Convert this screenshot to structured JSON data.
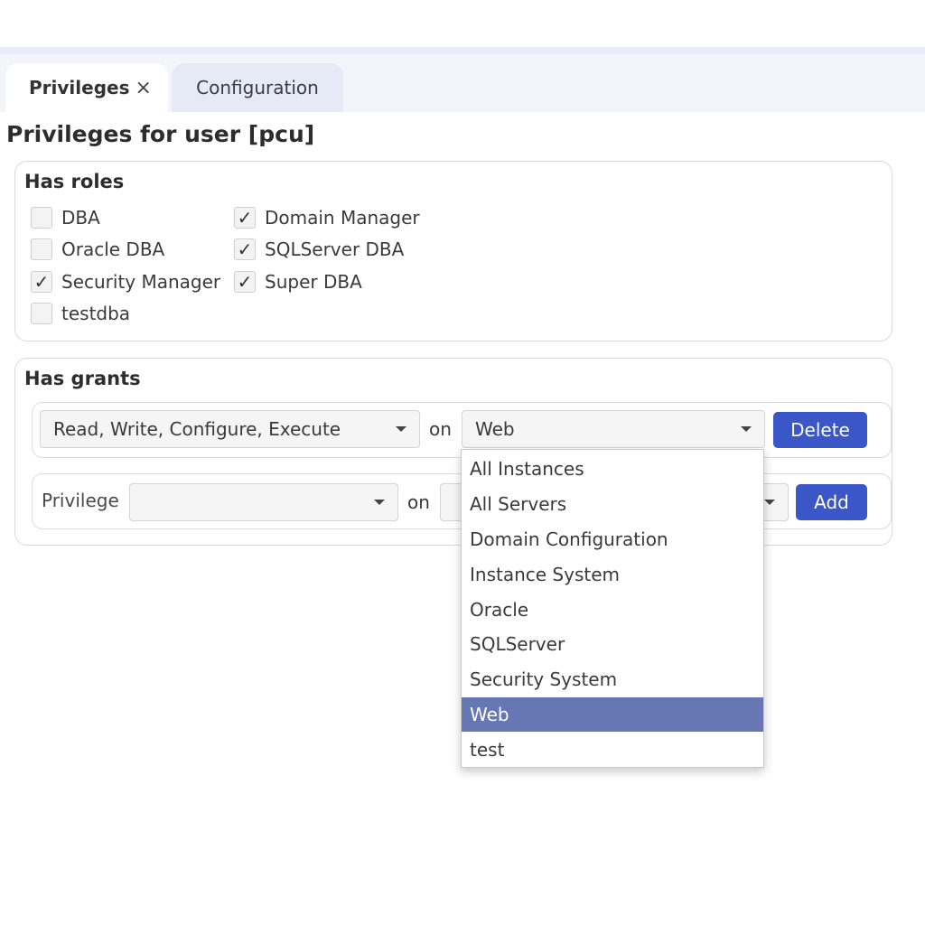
{
  "tabs": {
    "privileges_label": "Privileges",
    "privileges_close": "×",
    "configuration_label": "Configuration"
  },
  "page": {
    "title": "Privileges for user [pcu]"
  },
  "roles": {
    "heading": "Has roles",
    "items": [
      {
        "label": "DBA",
        "checked": false
      },
      {
        "label": "Domain Manager",
        "checked": true
      },
      {
        "label": "Oracle DBA",
        "checked": false
      },
      {
        "label": "SQLServer DBA",
        "checked": true
      },
      {
        "label": "Security Manager",
        "checked": true
      },
      {
        "label": "Super DBA",
        "checked": true
      },
      {
        "label": "testdba",
        "checked": false
      }
    ]
  },
  "grants": {
    "heading": "Has grants",
    "existing": {
      "privilege_value": "Read, Write, Configure, Execute",
      "on_label": "on",
      "target_value": "Web",
      "delete_label": "Delete"
    },
    "new_grant": {
      "privilege_label": "Privilege",
      "privilege_value": "",
      "on_label": "on",
      "add_label": "Add"
    }
  },
  "dropdown": {
    "options": [
      "All Instances",
      "All Servers",
      "Domain Configuration",
      "Instance System",
      "Oracle",
      "SQLServer",
      "Security System",
      "Web",
      "test"
    ],
    "selected": "Web"
  },
  "icons": {
    "check": "✓",
    "close": "×"
  },
  "colors": {
    "primary_button": "#3a56c7",
    "selected_option": "#6677b4"
  }
}
